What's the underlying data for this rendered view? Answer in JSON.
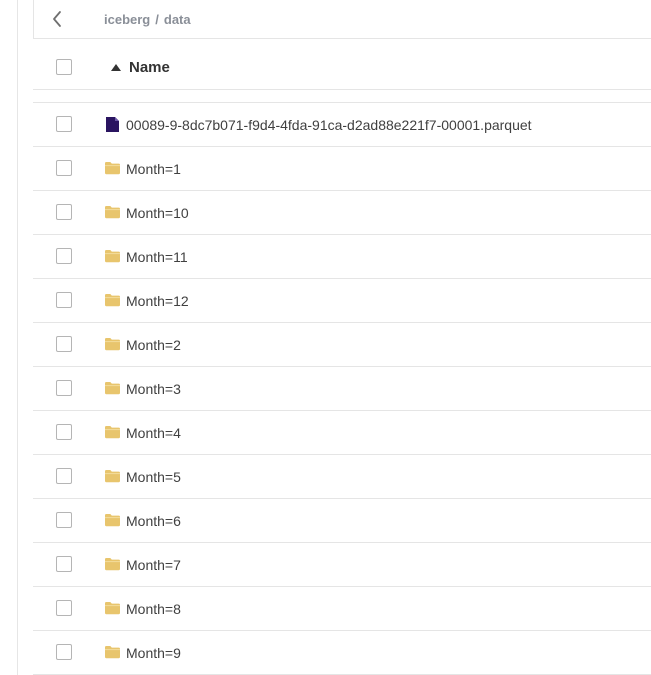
{
  "breadcrumb": {
    "root": "iceberg",
    "separator": "/",
    "current": "data"
  },
  "table": {
    "name_header": "Name",
    "sort_direction": "ascending",
    "rows": [
      {
        "name": "00089-9-8dc7b071-f9d4-4fda-91ca-d2ad88e221f7-00001.parquet",
        "type": "file"
      },
      {
        "name": "Month=1",
        "type": "folder"
      },
      {
        "name": "Month=10",
        "type": "folder"
      },
      {
        "name": "Month=11",
        "type": "folder"
      },
      {
        "name": "Month=12",
        "type": "folder"
      },
      {
        "name": "Month=2",
        "type": "folder"
      },
      {
        "name": "Month=3",
        "type": "folder"
      },
      {
        "name": "Month=4",
        "type": "folder"
      },
      {
        "name": "Month=5",
        "type": "folder"
      },
      {
        "name": "Month=6",
        "type": "folder"
      },
      {
        "name": "Month=7",
        "type": "folder"
      },
      {
        "name": "Month=8",
        "type": "folder"
      },
      {
        "name": "Month=9",
        "type": "folder"
      }
    ]
  },
  "icons": {
    "back": "chevron-left-icon",
    "sort": "caret-up-icon",
    "file": "document-icon",
    "folder": "folder-icon"
  },
  "colors": {
    "folder": "#e8c56d",
    "file": "#2a1460",
    "border": "#e5e5e5",
    "breadcrumb": "#8a8f98"
  }
}
